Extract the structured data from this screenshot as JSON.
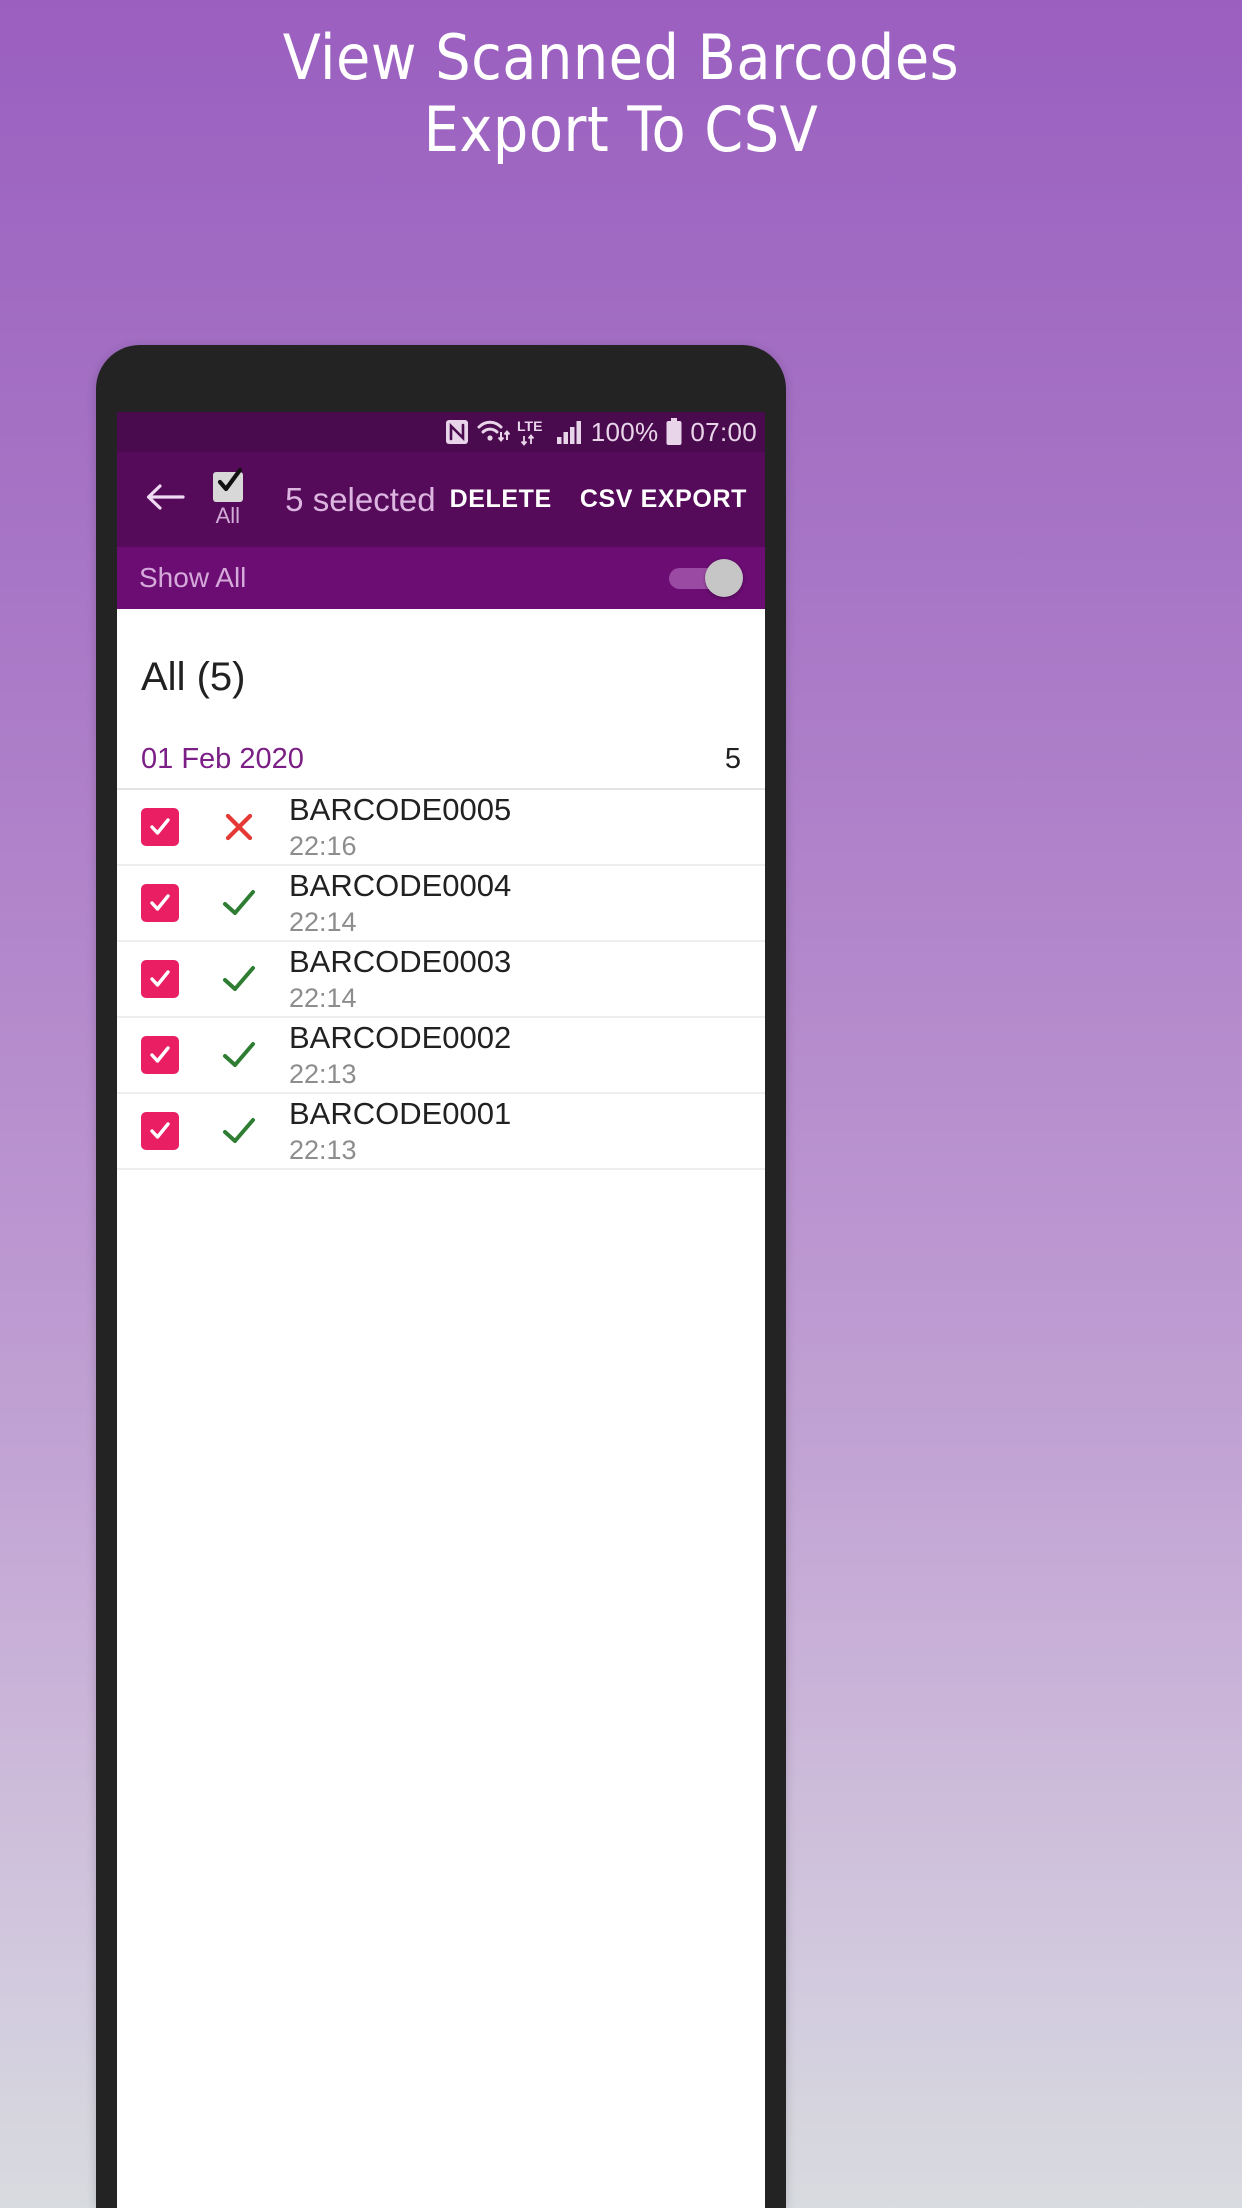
{
  "promo": {
    "line1": "View Scanned Barcodes",
    "line2": "Export To CSV",
    "text_color": "#ffffff",
    "bg_top": "#9b5fc0",
    "bg_bottom": "#d8dbe0"
  },
  "statusbar": {
    "icons": [
      "nfc-icon",
      "wifi-icon",
      "lte-icon",
      "signal-icon",
      "battery-icon"
    ],
    "battery_percent": "100%",
    "time": "07:00",
    "bg": "#4a0b4e"
  },
  "appbar": {
    "back_icon": "back-arrow-icon",
    "select_all_label": "All",
    "title": "5 selected",
    "actions": [
      {
        "label": "DELETE",
        "name": "delete-button"
      },
      {
        "label": "CSV EXPORT",
        "name": "csv-export-button"
      }
    ],
    "bg": "#550a5a"
  },
  "filter_bar": {
    "label": "Show All",
    "toggle_state": "on",
    "bg": "#6b0d73"
  },
  "list": {
    "title": "All (5)",
    "group": {
      "date": "01 Feb 2020",
      "count": "5"
    },
    "accent_checkbox": "#e91e63",
    "status_ok_color": "#2e7d32",
    "status_fail_color": "#e53935",
    "rows": [
      {
        "code": "BARCODE0005",
        "time": "22:16",
        "checked": true,
        "status": "fail"
      },
      {
        "code": "BARCODE0004",
        "time": "22:14",
        "checked": true,
        "status": "ok"
      },
      {
        "code": "BARCODE0003",
        "time": "22:14",
        "checked": true,
        "status": "ok"
      },
      {
        "code": "BARCODE0002",
        "time": "22:13",
        "checked": true,
        "status": "ok"
      },
      {
        "code": "BARCODE0001",
        "time": "22:13",
        "checked": true,
        "status": "ok"
      }
    ]
  }
}
